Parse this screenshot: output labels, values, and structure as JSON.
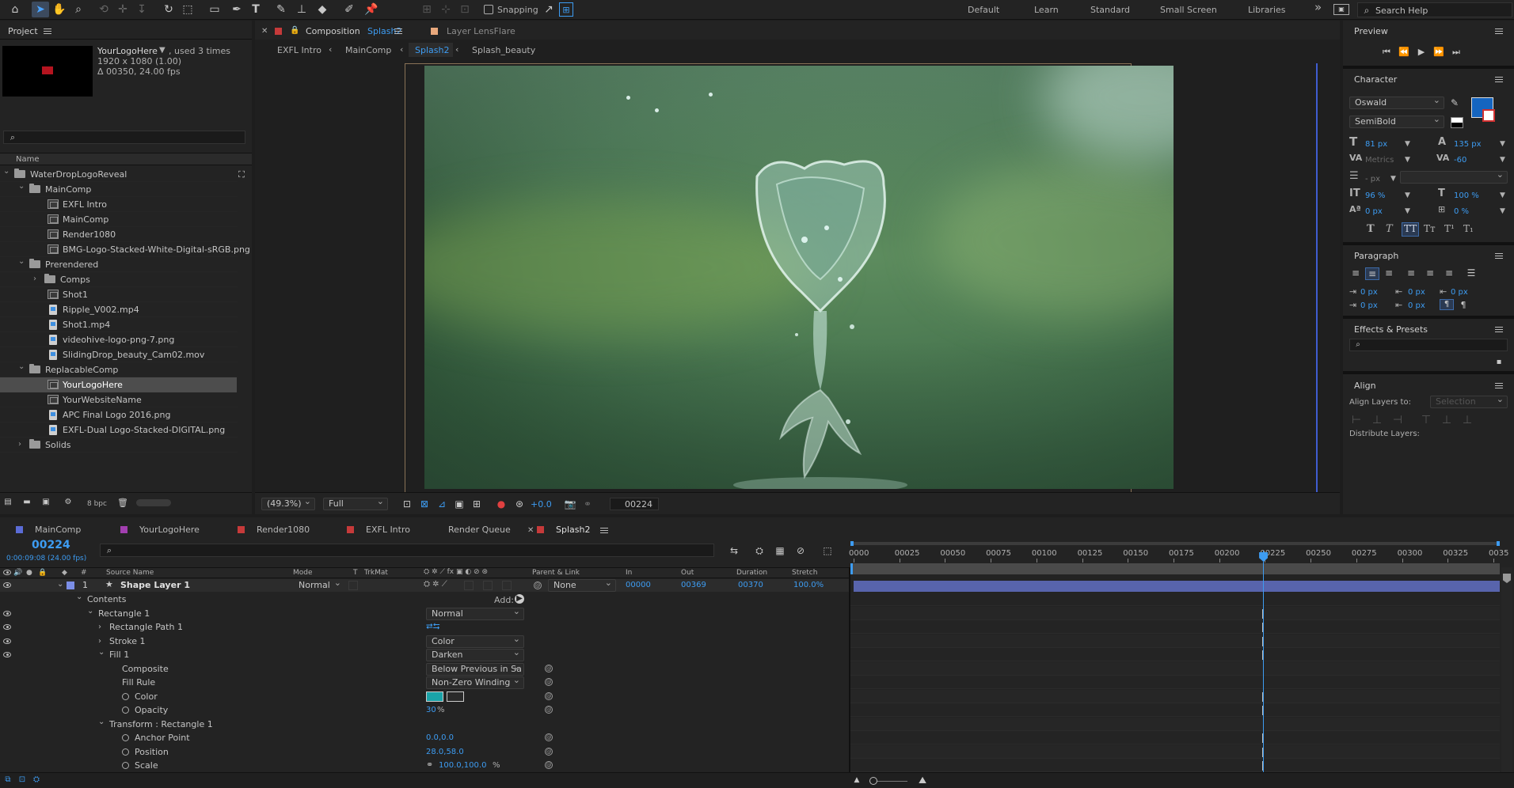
{
  "toolbar": {
    "snapping_label": "Snapping",
    "workspaces": [
      "Default",
      "Learn",
      "Standard",
      "Small Screen",
      "Libraries"
    ],
    "overflow": "»",
    "search_placeholder": "Search Help"
  },
  "project": {
    "title": "Project",
    "item_name": "YourLogoHere",
    "used": ", used 3 times",
    "resolution": "1920 x 1080 (1.00)",
    "duration": "Δ 00350, 24.00 fps",
    "search_placeholder": "",
    "col_name": "Name",
    "tree": [
      {
        "label": "WaterDropLogoReveal",
        "type": "folder",
        "depth": 0,
        "open": true
      },
      {
        "label": "MainComp",
        "type": "folder",
        "depth": 1,
        "open": true
      },
      {
        "label": "EXFL Intro",
        "type": "comp",
        "depth": 2
      },
      {
        "label": "MainComp",
        "type": "comp",
        "depth": 2
      },
      {
        "label": "Render1080",
        "type": "comp",
        "depth": 2
      },
      {
        "label": "BMG-Logo-Stacked-White-Digital-sRGB.png",
        "type": "comp",
        "depth": 2
      },
      {
        "label": "Prerendered",
        "type": "folder",
        "depth": 1,
        "open": true
      },
      {
        "label": "Comps",
        "type": "folder",
        "depth": 2,
        "open": false
      },
      {
        "label": "Shot1",
        "type": "comp",
        "depth": 2
      },
      {
        "label": "Ripple_V002.mp4",
        "type": "file",
        "depth": 2
      },
      {
        "label": "Shot1.mp4",
        "type": "file",
        "depth": 2
      },
      {
        "label": "videohive-logo-png-7.png",
        "type": "file",
        "depth": 2
      },
      {
        "label": "SlidingDrop_beauty_Cam02.mov",
        "type": "file",
        "depth": 2
      },
      {
        "label": "ReplacableComp",
        "type": "folder",
        "depth": 1,
        "open": true
      },
      {
        "label": "YourLogoHere",
        "type": "comp",
        "depth": 2,
        "selected": true
      },
      {
        "label": "YourWebsiteName",
        "type": "comp",
        "depth": 2
      },
      {
        "label": "APC Final Logo 2016.png",
        "type": "file",
        "depth": 2
      },
      {
        "label": "EXFL-Dual Logo-Stacked-DIGITAL.png",
        "type": "file",
        "depth": 2
      },
      {
        "label": "Solids",
        "type": "folder",
        "depth": 1,
        "open": false
      }
    ],
    "bpc": "8 bpc"
  },
  "composition": {
    "tab_prefix": "Composition",
    "tab_name": "Splash2",
    "layer_tab": "Layer LensFlare",
    "breadcrumbs": [
      "EXFL Intro",
      "MainComp",
      "Splash2",
      "Splash_beauty"
    ],
    "zoom": "(49.3%)",
    "resolution": "Full",
    "exposure": "+0.0",
    "timecode": "00224"
  },
  "preview": {
    "title": "Preview"
  },
  "character": {
    "title": "Character",
    "font": "Oswald",
    "style": "SemiBold",
    "size": "81 px",
    "leading": "135 px",
    "kerning": "Metrics",
    "tracking": "-60",
    "stroke": "- px",
    "vscale": "96 %",
    "hscale": "100 %",
    "baseline": "0 px",
    "tsume": "0 %",
    "fill_color": "#1565c0",
    "styles": [
      "T",
      "T",
      "TT",
      "Tт",
      "T¹",
      "T₁"
    ]
  },
  "paragraph": {
    "title": "Paragraph",
    "indent_left": "0 px",
    "indent_first": "0 px",
    "indent_right": "0 px",
    "space_before": "0 px",
    "space_after": "0 px"
  },
  "effects": {
    "title": "Effects & Presets"
  },
  "align": {
    "title": "Align",
    "align_to_label": "Align Layers to:",
    "align_to_value": "Selection",
    "distribute": "Distribute Layers:"
  },
  "timeline": {
    "tabs": [
      {
        "label": "MainComp",
        "color": "#5b6cd6"
      },
      {
        "label": "YourLogoHere",
        "color": "#a23fb0"
      },
      {
        "label": "Render1080",
        "color": "#c63a3a"
      },
      {
        "label": "EXFL Intro",
        "color": "#c63a3a"
      },
      {
        "label": "Render Queue",
        "color": ""
      },
      {
        "label": "Splash2",
        "color": "#c63a3a",
        "active": true
      }
    ],
    "timecode": "00224",
    "timecode_sub": "0:00:09:08 (24.00 fps)",
    "columns": [
      "#",
      "Source Name",
      "Mode",
      "T",
      "TrkMat",
      "Parent & Link",
      "In",
      "Out",
      "Duration",
      "Stretch"
    ],
    "layer": {
      "num": "1",
      "name": "Shape Layer 1",
      "mode": "Normal",
      "parent": "None",
      "in": "00000",
      "out": "00369",
      "duration": "00370",
      "stretch": "100.0%"
    },
    "add_label": "Add:",
    "props": [
      {
        "label": "Contents",
        "depth": 1,
        "arrow": "⌄",
        "eye": false
      },
      {
        "label": "Rectangle 1",
        "depth": 2,
        "arrow": "⌄",
        "eye": true,
        "value": "Normal",
        "value_type": "dd"
      },
      {
        "label": "Rectangle Path 1",
        "depth": 3,
        "arrow": "›",
        "eye": true,
        "value_type": "path"
      },
      {
        "label": "Stroke 1",
        "depth": 3,
        "arrow": "›",
        "eye": true,
        "value": "Color",
        "value_type": "dd"
      },
      {
        "label": "Fill 1",
        "depth": 3,
        "arrow": "⌄",
        "eye": true,
        "value": "Darken",
        "value_type": "dd"
      },
      {
        "label": "Composite",
        "depth": 4,
        "arrow": "",
        "eye": false,
        "value": "Below Previous in Sa",
        "value_type": "dd",
        "link": true
      },
      {
        "label": "Fill Rule",
        "depth": 4,
        "arrow": "",
        "eye": false,
        "value": "Non-Zero Winding",
        "value_type": "dd",
        "link": true
      },
      {
        "label": "Color",
        "depth": 4,
        "arrow": "",
        "eye": false,
        "stopwatch": true,
        "value_type": "color",
        "link": true
      },
      {
        "label": "Opacity",
        "depth": 4,
        "arrow": "",
        "eye": false,
        "stopwatch": true,
        "value": "30",
        "unit": "%",
        "value_type": "num",
        "link": true
      },
      {
        "label": "Transform : Rectangle 1",
        "depth": 3,
        "arrow": "⌄",
        "eye": false
      },
      {
        "label": "Anchor Point",
        "depth": 4,
        "arrow": "",
        "eye": false,
        "stopwatch": true,
        "value": "0.0,0.0",
        "value_type": "num",
        "link": true
      },
      {
        "label": "Position",
        "depth": 4,
        "arrow": "",
        "eye": false,
        "stopwatch": true,
        "value": "28.0,58.0",
        "value_type": "num",
        "link": true
      },
      {
        "label": "Scale",
        "depth": 4,
        "arrow": "",
        "eye": false,
        "stopwatch": true,
        "value": "100.0,100.0",
        "unit": "%",
        "value_type": "scale",
        "link": true
      }
    ],
    "ruler": [
      "0000",
      "00025",
      "00050",
      "00075",
      "00100",
      "00125",
      "00150",
      "00175",
      "00200",
      "00225",
      "00250",
      "00275",
      "00300",
      "00325",
      "0035"
    ],
    "playhead_frame": 224,
    "total_frames": 355,
    "fill_color": "#1aa3a8"
  }
}
